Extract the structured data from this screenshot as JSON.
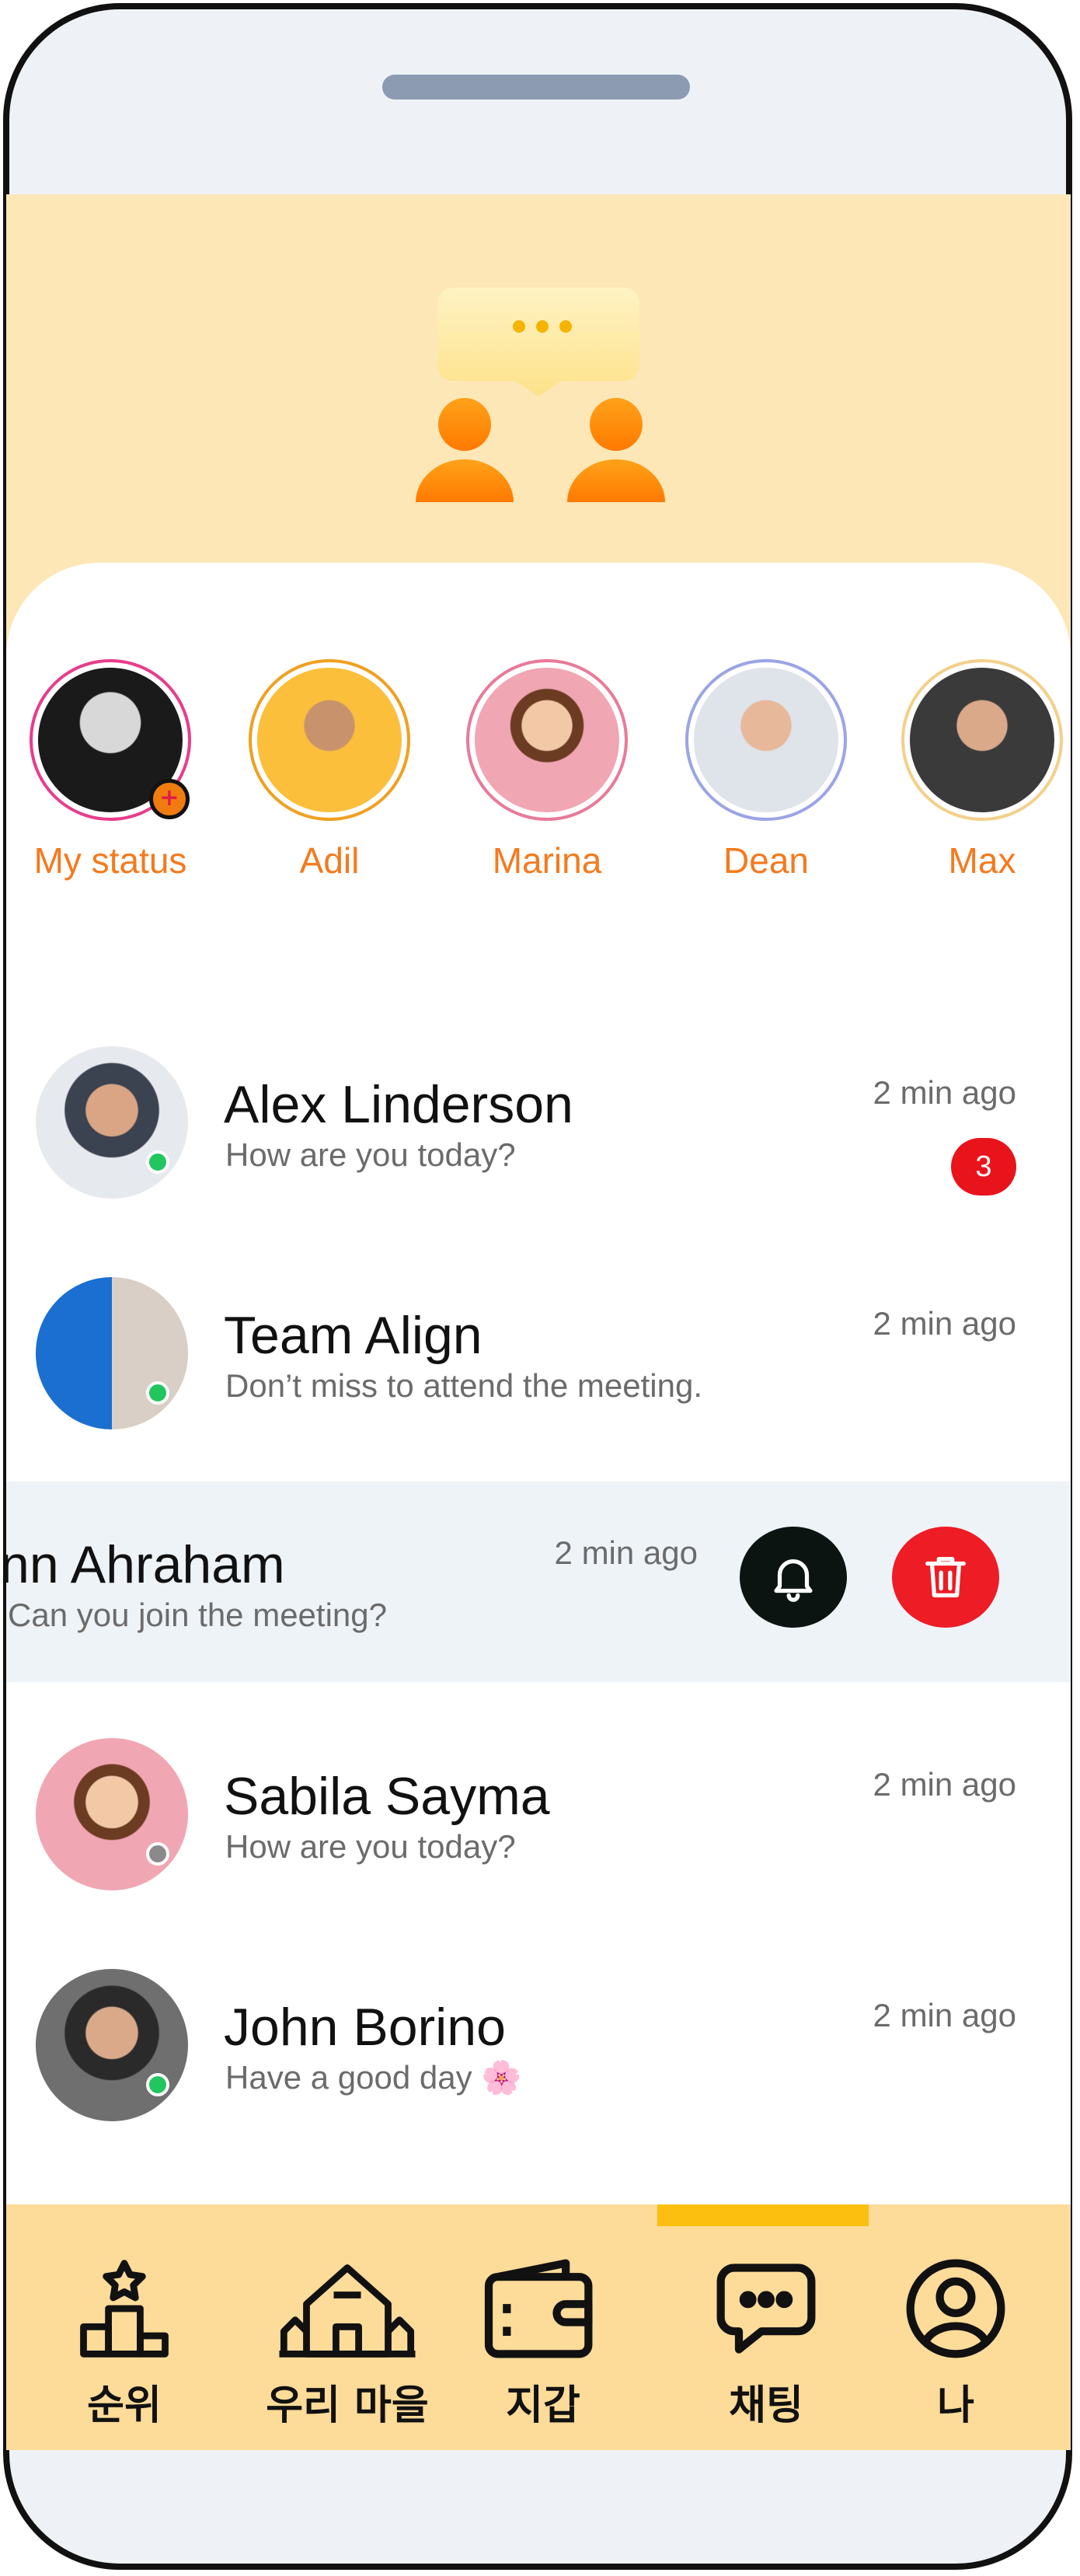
{
  "stories": [
    {
      "name": "My status",
      "ring": "#e83c8c",
      "bg": "#222222"
    },
    {
      "name": "Adil",
      "ring": "#f0a020",
      "bg": "#fbbf3c"
    },
    {
      "name": "Marina",
      "ring": "#e87a9a",
      "bg": "#f1a6b3"
    },
    {
      "name": "Dean",
      "ring": "#9aa4e6",
      "bg": "#dfe3ea"
    },
    {
      "name": "Max",
      "ring": "#f3d08a",
      "bg": "#6b6b6b"
    }
  ],
  "chats": [
    {
      "name": "Alex Linderson",
      "message": "How are you today?",
      "time": "2 min ago",
      "unread": "3",
      "status": "online"
    },
    {
      "name": "Team Align",
      "message": "Don’t miss to attend the meeting.",
      "time": "2 min ago",
      "status": "online"
    },
    {
      "name": "nn Ahraham",
      "message": "Can you join the meeting?",
      "time": "2 min ago",
      "swiped": true
    },
    {
      "name": "Sabila Sayma",
      "message": "How are you today?",
      "time": "2 min ago",
      "status": "offline"
    },
    {
      "name": "John Borino",
      "message": "Have a good day 🌸",
      "time": "2 min ago",
      "status": "online"
    }
  ],
  "nav": [
    {
      "label": "순위",
      "icon": "ranking-icon"
    },
    {
      "label": "우리 마을",
      "icon": "village-icon"
    },
    {
      "label": "지갑",
      "icon": "wallet-icon"
    },
    {
      "label": "채팅",
      "icon": "chat-icon",
      "active": true
    },
    {
      "label": "나",
      "icon": "profile-icon"
    }
  ],
  "colors": {
    "accent": "#f47a1f",
    "online": "#22c55e",
    "offline": "#8a8a8a",
    "danger": "#e8131b"
  }
}
